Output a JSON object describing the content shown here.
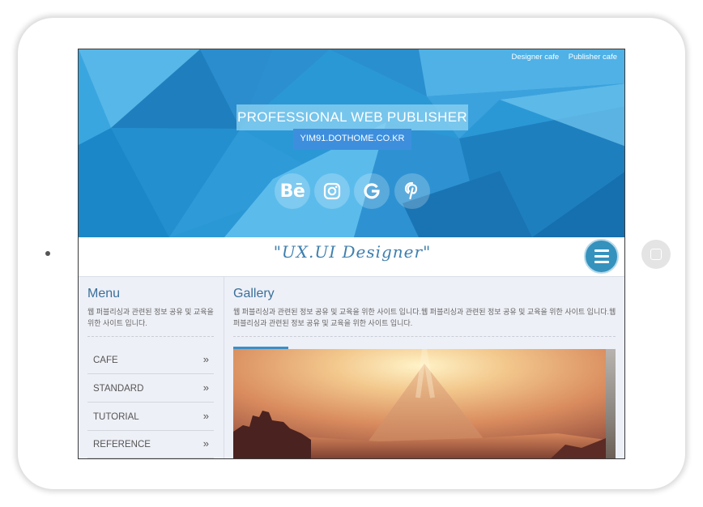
{
  "top_links": [
    "Designer cafe",
    "Publisher cafe"
  ],
  "hero": {
    "title": "PROFESSIONAL WEB PUBLISHER",
    "url": "YIM91.DOTHOME.CO.KR",
    "social": [
      "behance-icon",
      "instagram-icon",
      "google-icon",
      "pinterest-icon"
    ],
    "behance_label": "Bē"
  },
  "slogan": "\"UX.UI Designer\"",
  "sidebar": {
    "title": "Menu",
    "desc": "웹 퍼블리싱과 관련된 정보 공유 및 교육을 위한 사이트 입니다.",
    "items": [
      {
        "label": "CAFE",
        "arrow": "»"
      },
      {
        "label": "STANDARD",
        "arrow": "»"
      },
      {
        "label": "TUTORIAL",
        "arrow": "»"
      },
      {
        "label": "REFERENCE",
        "arrow": "»"
      }
    ]
  },
  "main": {
    "title": "Gallery",
    "desc": "웹 퍼블리싱과 관련된 정보 공유 및 교육을 위한 사이트 입니다.웹 퍼블리싱과 관련된 정보 공유 및 교육을 위한 사이트 입니다.웹 퍼블리싱과 관련된 정보 공유 및 교육을 위한 사이트 입니다."
  },
  "colors": {
    "hero_blue": "#2b98d6",
    "accent": "#3a6f9a",
    "menu_button": "#3592bd"
  }
}
